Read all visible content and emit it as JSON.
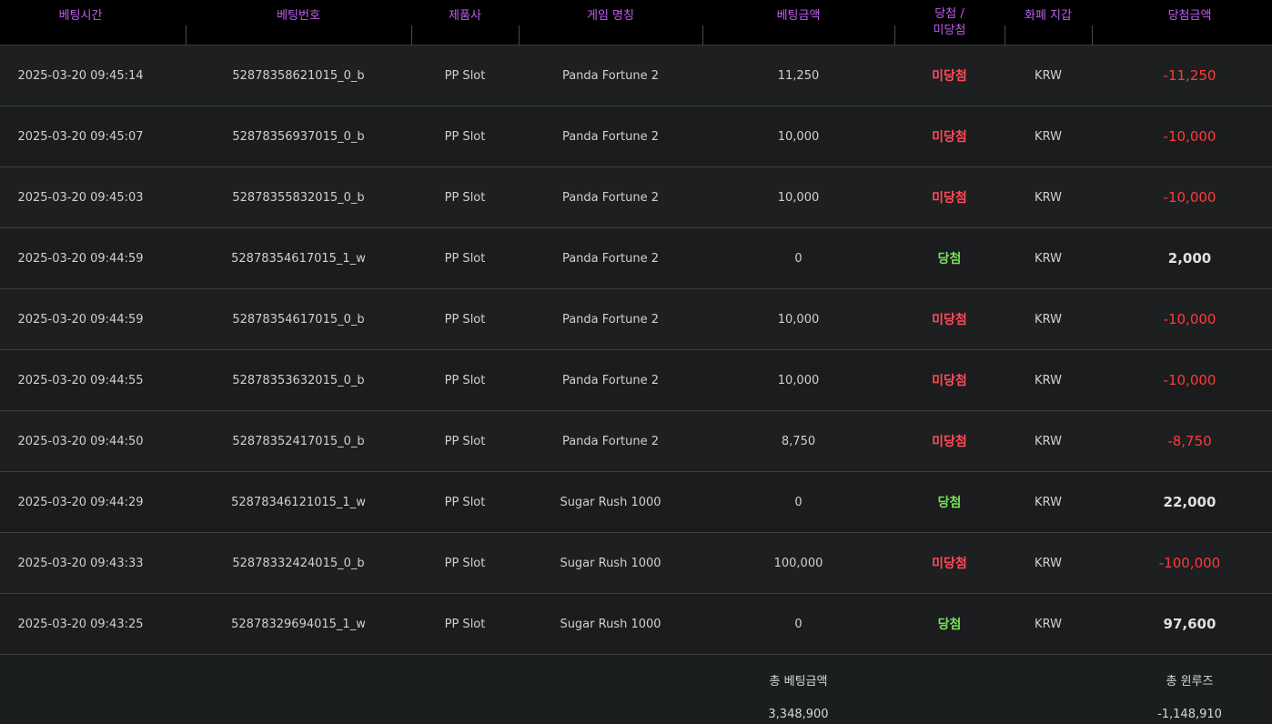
{
  "header": {
    "bet_time": "베팅시간",
    "bet_number": "베팅번호",
    "provider": "제품사",
    "game_name": "게임 명칭",
    "bet_amount": "베팅금액",
    "result_line1": "당첨 /",
    "result_line2": "미당첨",
    "currency_wallet": "화폐 지갑",
    "win_amount": "당첨금액"
  },
  "rows": [
    {
      "time": "2025-03-20 09:45:14",
      "bet_no": "52878358621015_0_b",
      "provider": "PP Slot",
      "game": "Panda Fortune 2",
      "amount": "11,250",
      "result": "미당첨",
      "status": "lose",
      "currency": "KRW",
      "win": "-11,250"
    },
    {
      "time": "2025-03-20 09:45:07",
      "bet_no": "52878356937015_0_b",
      "provider": "PP Slot",
      "game": "Panda Fortune 2",
      "amount": "10,000",
      "result": "미당첨",
      "status": "lose",
      "currency": "KRW",
      "win": "-10,000"
    },
    {
      "time": "2025-03-20 09:45:03",
      "bet_no": "52878355832015_0_b",
      "provider": "PP Slot",
      "game": "Panda Fortune 2",
      "amount": "10,000",
      "result": "미당첨",
      "status": "lose",
      "currency": "KRW",
      "win": "-10,000"
    },
    {
      "time": "2025-03-20 09:44:59",
      "bet_no": "52878354617015_1_w",
      "provider": "PP Slot",
      "game": "Panda Fortune 2",
      "amount": "0",
      "result": "당첨",
      "status": "win",
      "currency": "KRW",
      "win": "2,000"
    },
    {
      "time": "2025-03-20 09:44:59",
      "bet_no": "52878354617015_0_b",
      "provider": "PP Slot",
      "game": "Panda Fortune 2",
      "amount": "10,000",
      "result": "미당첨",
      "status": "lose",
      "currency": "KRW",
      "win": "-10,000"
    },
    {
      "time": "2025-03-20 09:44:55",
      "bet_no": "52878353632015_0_b",
      "provider": "PP Slot",
      "game": "Panda Fortune 2",
      "amount": "10,000",
      "result": "미당첨",
      "status": "lose",
      "currency": "KRW",
      "win": "-10,000"
    },
    {
      "time": "2025-03-20 09:44:50",
      "bet_no": "52878352417015_0_b",
      "provider": "PP Slot",
      "game": "Panda Fortune 2",
      "amount": "8,750",
      "result": "미당첨",
      "status": "lose",
      "currency": "KRW",
      "win": "-8,750"
    },
    {
      "time": "2025-03-20 09:44:29",
      "bet_no": "52878346121015_1_w",
      "provider": "PP Slot",
      "game": "Sugar Rush 1000",
      "amount": "0",
      "result": "당첨",
      "status": "win",
      "currency": "KRW",
      "win": "22,000"
    },
    {
      "time": "2025-03-20 09:43:33",
      "bet_no": "52878332424015_0_b",
      "provider": "PP Slot",
      "game": "Sugar Rush 1000",
      "amount": "100,000",
      "result": "미당첨",
      "status": "lose",
      "currency": "KRW",
      "win": "-100,000"
    },
    {
      "time": "2025-03-20 09:43:25",
      "bet_no": "52878329694015_1_w",
      "provider": "PP Slot",
      "game": "Sugar Rush 1000",
      "amount": "0",
      "result": "당첨",
      "status": "win",
      "currency": "KRW",
      "win": "97,600"
    }
  ],
  "footer": {
    "total_bet_label": "총 베팅금액",
    "total_bet_value": "3,348,900",
    "total_winloss_label": "총 윈루즈",
    "total_winloss_value": "-1,148,910"
  },
  "colors": {
    "header_text": "#c05df2",
    "lose": "#ff4a5a",
    "win": "#7ae05a",
    "negative_amount": "#ff3a3a"
  }
}
